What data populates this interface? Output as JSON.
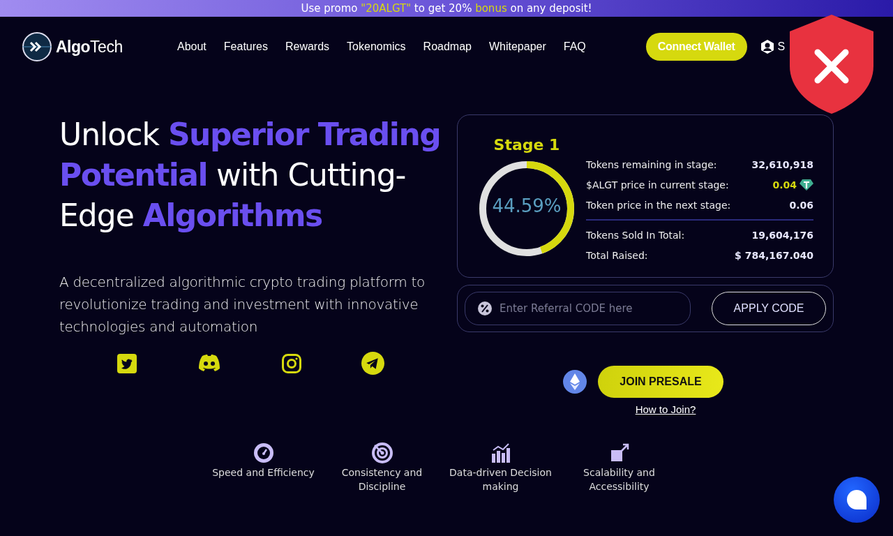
{
  "promo": [
    {
      "text": "Use promo ",
      "highlight": false
    },
    {
      "text": "\"20ALGT\"",
      "highlight": true
    },
    {
      "text": " to get 20% ",
      "highlight": false
    },
    {
      "text": "bonus",
      "highlight": true
    },
    {
      "text": " on any deposit!",
      "highlight": false
    }
  ],
  "header": {
    "logo": {
      "word_a": "Algo",
      "word_b": "Tech"
    },
    "nav": [
      "About",
      "Features",
      "Rewards",
      "Tokenomics",
      "Roadmap",
      "Whitepaper",
      "FAQ"
    ],
    "connect_button": "Connect Wallet",
    "user_link": "S"
  },
  "hero": {
    "headline": [
      {
        "text": "Unlock ",
        "highlight": false
      },
      {
        "text": "Superior Trading Potential",
        "highlight": true
      },
      {
        "text": " with Cutting-Edge ",
        "highlight": false
      },
      {
        "text": "Algorithms",
        "highlight": true
      }
    ],
    "description": "A decentralized algorithmic crypto trading platform to revolutionize trading and investment with innovative technologies and automation",
    "socials": [
      {
        "kind": "twitter"
      },
      {
        "kind": "discord"
      },
      {
        "kind": "instagram"
      },
      {
        "kind": "telegram"
      }
    ]
  },
  "presale": {
    "stage": "Stage 1",
    "level": 0.4459,
    "percent": "44.59%",
    "stats": [
      {
        "label": "Tokens remaining in stage:",
        "value": "32,610,918",
        "kind": "plain"
      },
      {
        "label": "$ALGT price in current stage:",
        "value": "0.04",
        "kind": "price"
      },
      {
        "label": "Token price in the next stage:",
        "value": "0.06",
        "kind": "plain"
      }
    ],
    "totals": [
      {
        "label": "Tokens Sold In Total:",
        "value": "19,604,176"
      },
      {
        "label": "Total Raised:",
        "value": "$ 784,167.040"
      }
    ],
    "referral_placeholder": "Enter Referral CODE here",
    "apply_button": "APPLY CODE",
    "join_button": "JOIN PRESALE",
    "how_link": "How to Join?"
  },
  "features": [
    {
      "kind": "gauge",
      "label": "Speed and Efficiency"
    },
    {
      "kind": "target",
      "label": "Consistency and Discipline"
    },
    {
      "kind": "chart",
      "label": "Data-driven Decision making"
    },
    {
      "kind": "scale",
      "label": "Scalability and Accessibility"
    }
  ]
}
